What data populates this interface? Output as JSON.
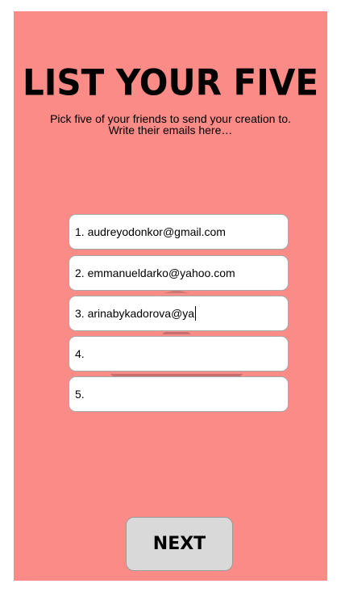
{
  "screen": {
    "title": "LIST YOUR FIVE",
    "subtitle_line1": "Pick five of your friends to send your creation to.",
    "subtitle_line2": "Write their emails here…",
    "background_color": "#fb8b86"
  },
  "emails": [
    {
      "value": "1. audreyodonkor@gmail.com"
    },
    {
      "value": "2. emmanueldarko@yahoo.com"
    },
    {
      "value": "3. arinabykadorova@ya",
      "focused": true
    },
    {
      "value": "4."
    },
    {
      "value": "5."
    }
  ],
  "next_button": {
    "label": "NEXT"
  }
}
